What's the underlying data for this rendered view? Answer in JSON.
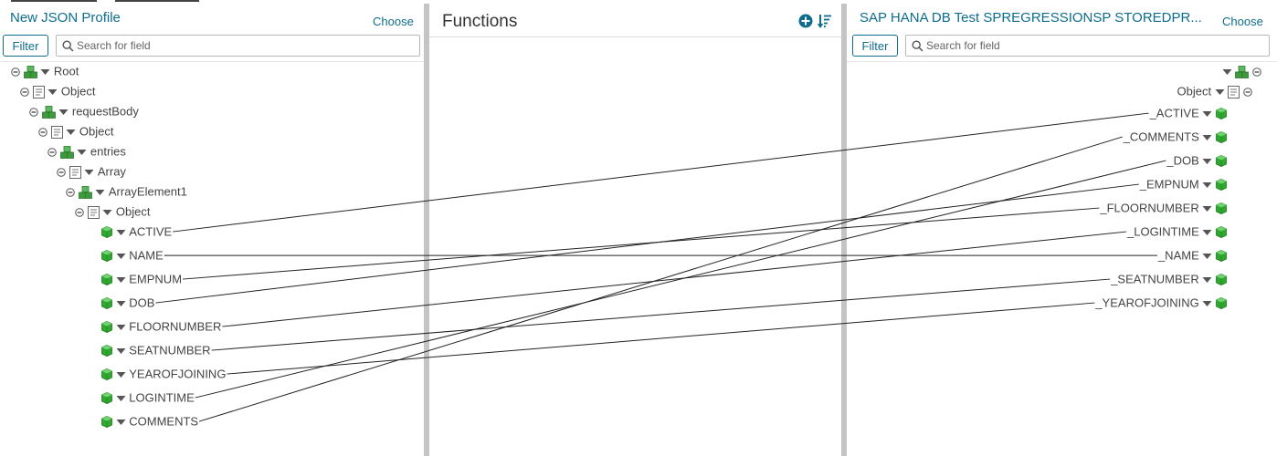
{
  "left_panel": {
    "title": "New JSON Profile",
    "choose_label": "Choose",
    "filter_label": "Filter",
    "search_placeholder": "Search for field",
    "tree": [
      {
        "label": "Root",
        "kind": "group",
        "toggle": true,
        "depth": 0
      },
      {
        "label": "Object",
        "kind": "object",
        "toggle": true,
        "depth": 1
      },
      {
        "label": "requestBody",
        "kind": "group",
        "toggle": true,
        "depth": 2
      },
      {
        "label": "Object",
        "kind": "object",
        "toggle": true,
        "depth": 3
      },
      {
        "label": "entries",
        "kind": "group",
        "toggle": true,
        "depth": 4
      },
      {
        "label": "Array",
        "kind": "object",
        "toggle": true,
        "depth": 5
      },
      {
        "label": "ArrayElement1",
        "kind": "group",
        "toggle": true,
        "depth": 6
      },
      {
        "label": "Object",
        "kind": "object",
        "toggle": true,
        "depth": 7
      },
      {
        "label": "ACTIVE",
        "kind": "field",
        "toggle": false,
        "depth": 8
      },
      {
        "label": "NAME",
        "kind": "field",
        "toggle": false,
        "depth": 8
      },
      {
        "label": "EMPNUM",
        "kind": "field",
        "toggle": false,
        "depth": 8
      },
      {
        "label": "DOB",
        "kind": "field",
        "toggle": false,
        "depth": 8
      },
      {
        "label": "FLOORNUMBER",
        "kind": "field",
        "toggle": false,
        "depth": 8
      },
      {
        "label": "SEATNUMBER",
        "kind": "field",
        "toggle": false,
        "depth": 8
      },
      {
        "label": "YEAROFJOINING",
        "kind": "field",
        "toggle": false,
        "depth": 8
      },
      {
        "label": "LOGINTIME",
        "kind": "field",
        "toggle": false,
        "depth": 8
      },
      {
        "label": "COMMENTS",
        "kind": "field",
        "toggle": false,
        "depth": 8
      }
    ]
  },
  "functions_panel": {
    "title": "Functions",
    "icons": [
      "add-function-icon",
      "sort-icon"
    ]
  },
  "right_panel": {
    "title": "SAP HANA DB Test SPREGRESSIONSP STOREDPR...",
    "choose_label": "Choose",
    "filter_label": "Filter",
    "search_placeholder": "Search for field",
    "tree": [
      {
        "label": "",
        "kind": "group",
        "toggle": true
      },
      {
        "label": "Object",
        "kind": "object",
        "toggle": true
      },
      {
        "label": "_ACTIVE",
        "kind": "field",
        "toggle": false
      },
      {
        "label": "_COMMENTS",
        "kind": "field",
        "toggle": false
      },
      {
        "label": "_DOB",
        "kind": "field",
        "toggle": false
      },
      {
        "label": "_EMPNUM",
        "kind": "field",
        "toggle": false
      },
      {
        "label": "_FLOORNUMBER",
        "kind": "field",
        "toggle": false
      },
      {
        "label": "_LOGINTIME",
        "kind": "field",
        "toggle": false
      },
      {
        "label": "_NAME",
        "kind": "field",
        "toggle": false
      },
      {
        "label": "_SEATNUMBER",
        "kind": "field",
        "toggle": false
      },
      {
        "label": "_YEAROFJOINING",
        "kind": "field",
        "toggle": false
      }
    ]
  },
  "mappings": [
    {
      "from": "ACTIVE",
      "to": "_ACTIVE"
    },
    {
      "from": "NAME",
      "to": "_NAME"
    },
    {
      "from": "EMPNUM",
      "to": "_FLOORNUMBER"
    },
    {
      "from": "DOB",
      "to": "_EMPNUM"
    },
    {
      "from": "FLOORNUMBER",
      "to": "_LOGINTIME"
    },
    {
      "from": "SEATNUMBER",
      "to": "_SEATNUMBER"
    },
    {
      "from": "YEAROFJOINING",
      "to": "_YEAROFJOINING"
    },
    {
      "from": "LOGINTIME",
      "to": "_DOB"
    },
    {
      "from": "COMMENTS",
      "to": "_COMMENTS"
    }
  ],
  "colors": {
    "accent": "#0e6d8c",
    "field_icon": "#2fa82f",
    "group_icon": "#3c9a3c",
    "splitter": "#c4c4c4",
    "link_line": "#222222"
  }
}
